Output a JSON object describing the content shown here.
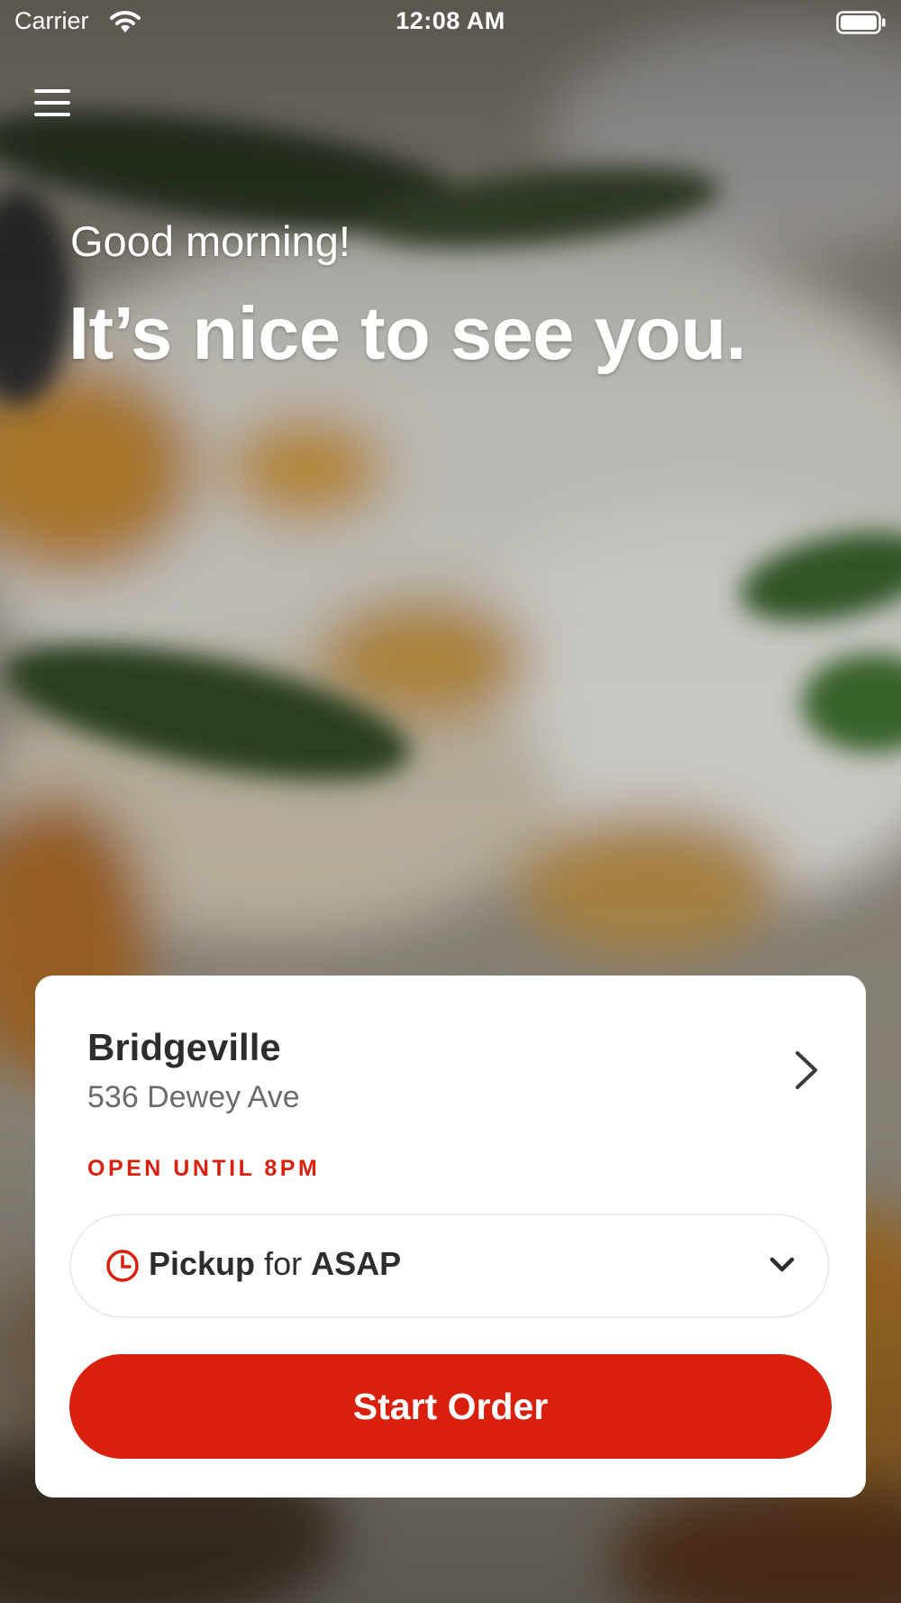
{
  "status_bar": {
    "carrier": "Carrier",
    "time": "12:08 AM"
  },
  "icons": {
    "menu": "hamburger-menu-icon",
    "wifi": "wifi-icon",
    "battery": "battery-icon",
    "chevron_right": "chevron-right-icon",
    "clock": "clock-icon",
    "chevron_down": "chevron-down-icon"
  },
  "hero": {
    "greeting": "Good morning!",
    "headline": "It’s nice to see you."
  },
  "location": {
    "name": "Bridgeville",
    "address": "536 Dewey Ave",
    "hours": "OPEN UNTIL 8PM"
  },
  "order_mode": {
    "mode": "Pickup",
    "connector": "for",
    "time": "ASAP"
  },
  "actions": {
    "start_order_label": "Start Order"
  },
  "colors": {
    "accent": "#d8200c",
    "card_background": "#ffffff",
    "text_primary": "#2d2d2d",
    "text_secondary": "#6b6b6b"
  }
}
